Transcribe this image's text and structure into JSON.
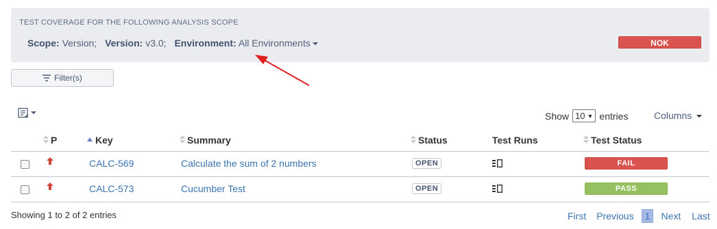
{
  "scope": {
    "caption": "TEST COVERAGE FOR THE FOLLOWING ANALYSIS SCOPE",
    "scope_label": "Scope:",
    "scope_value": "Version;",
    "version_label": "Version:",
    "version_value": "v3.0;",
    "environment_label": "Environment:",
    "environment_value": "All Environments",
    "overall_status": "NOK",
    "overall_status_color": "#d9534f"
  },
  "toolbar": {
    "filter_label": "Filter(s)",
    "filter_icon": "filter-lines-icon",
    "layout_icon": "layout-list-icon",
    "show_label": "Show",
    "entries_value": "10",
    "entries_suffix": "entries",
    "columns_label": "Columns"
  },
  "table": {
    "headers": {
      "priority": "P",
      "key": "Key",
      "summary": "Summary",
      "status": "Status",
      "test_runs": "Test Runs",
      "test_status": "Test Status"
    },
    "sorted_column": "Key",
    "rows": [
      {
        "priority_icon": "arrow-up-icon",
        "key": "CALC-569",
        "summary": "Calculate the sum of 2 numbers",
        "status": "OPEN",
        "test_runs_icon": "test-runs-icon",
        "test_status": "FAIL",
        "test_status_color": "#d9534f"
      },
      {
        "priority_icon": "arrow-up-icon",
        "key": "CALC-573",
        "summary": "Cucumber Test",
        "status": "OPEN",
        "test_runs_icon": "test-runs-icon",
        "test_status": "PASS",
        "test_status_color": "#95c160"
      }
    ]
  },
  "footer": {
    "info": "Showing 1 to 2 of 2 entries",
    "first": "First",
    "previous": "Previous",
    "current_page": "1",
    "next": "Next",
    "last": "Last"
  },
  "colors": {
    "panel_bg": "#ebecf0",
    "link": "#3b73af",
    "annotation_arrow": "#e02020"
  }
}
